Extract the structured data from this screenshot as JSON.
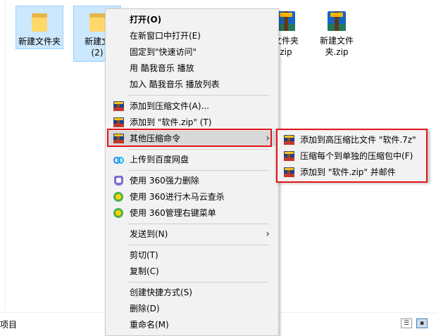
{
  "desktop": {
    "items": [
      {
        "label": "新建文件夹",
        "type": "folder",
        "selected": true
      },
      {
        "label": "新建文件夹 (2)",
        "line1": "新建文",
        "line2": "(2)",
        "type": "folder",
        "selected": true
      },
      {
        "label": "文件夹.zip",
        "line1": "文件夹",
        "line2": "zip",
        "type": "zip"
      },
      {
        "label": "新建文件夹.zip",
        "line1": "新建文件",
        "line2": "夹.zip",
        "type": "zip"
      }
    ]
  },
  "status": {
    "left_text": "项目"
  },
  "context_menu": {
    "items": [
      {
        "id": "open",
        "label": "打开(O)",
        "bold": true
      },
      {
        "id": "open-new-window",
        "label": "在新窗口中打开(E)"
      },
      {
        "id": "pin-quick-access",
        "label": "固定到\"快速访问\""
      },
      {
        "id": "kuwo-play",
        "label": "用 酷我音乐 播放"
      },
      {
        "id": "kuwo-add-playlist",
        "label": "加入 酷我音乐 播放列表"
      },
      {
        "id": "add-to-archive",
        "label": "添加到压缩文件(A)...",
        "icon": "winrar-icon"
      },
      {
        "id": "add-to-zip",
        "label": "添加到 \"软件.zip\" (T)",
        "icon": "winrar-icon"
      },
      {
        "id": "other-compress",
        "label": "其他压缩命令",
        "icon": "winrar-icon",
        "submenu": true,
        "highlighted": true
      },
      {
        "id": "upload-baidu",
        "label": "上传到百度网盘",
        "icon": "baidu-netdisk-icon"
      },
      {
        "id": "360-force-delete",
        "label": "使用 360强力删除",
        "icon": "360-shield-icon"
      },
      {
        "id": "360-trojan-scan",
        "label": "使用 360进行木马云查杀",
        "icon": "360-ball-icon"
      },
      {
        "id": "360-menu-manage",
        "label": "使用 360管理右键菜单",
        "icon": "360-ball-icon"
      },
      {
        "id": "send-to",
        "label": "发送到(N)",
        "submenu": true
      },
      {
        "id": "cut",
        "label": "剪切(T)"
      },
      {
        "id": "copy",
        "label": "复制(C)"
      },
      {
        "id": "create-shortcut",
        "label": "创建快捷方式(S)"
      },
      {
        "id": "delete",
        "label": "删除(D)"
      },
      {
        "id": "rename",
        "label": "重命名(M)"
      }
    ]
  },
  "submenu": {
    "items": [
      {
        "id": "add-7z",
        "label": "添加到高压缩比文件 \"软件.7z\"",
        "icon": "winrar-icon"
      },
      {
        "id": "compress-each",
        "label": "压缩每个到单独的压缩包中(F)",
        "icon": "winrar-icon"
      },
      {
        "id": "add-zip-email",
        "label": "添加到 \"软件.zip\" 并邮件",
        "icon": "winrar-icon"
      }
    ]
  },
  "colors": {
    "highlight_box": "#e2151b",
    "menu_bg": "#f2f2f2",
    "selection_bg": "#cce8ff"
  }
}
